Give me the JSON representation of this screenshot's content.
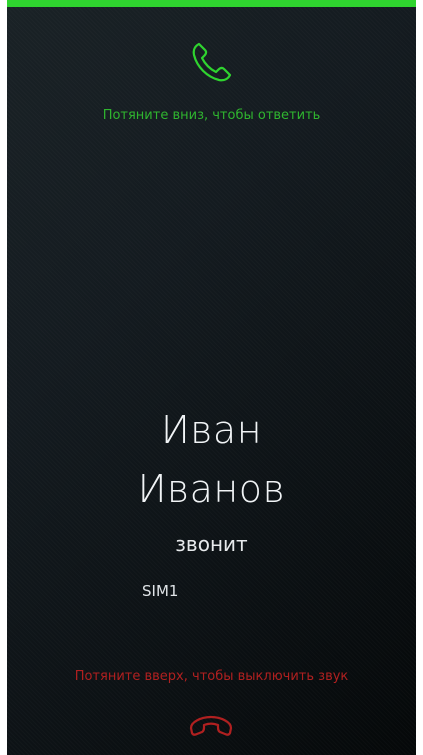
{
  "colors": {
    "accept": "#2fd42f",
    "accept_text": "#2fb52f",
    "decline": "#b02020",
    "background_dark": "#050809",
    "text_primary": "#f1f4f6"
  },
  "incoming_call": {
    "answer_icon": "phone-handset-icon",
    "answer_hint": "Потяните вниз, чтобы ответить",
    "caller_first_name": "Иван",
    "caller_last_name": "Иванов",
    "status": "звонит",
    "sim": "SIM1",
    "mute_hint": "Потяните вверх, чтобы выключить звук",
    "decline_icon": "hang-up-icon"
  }
}
